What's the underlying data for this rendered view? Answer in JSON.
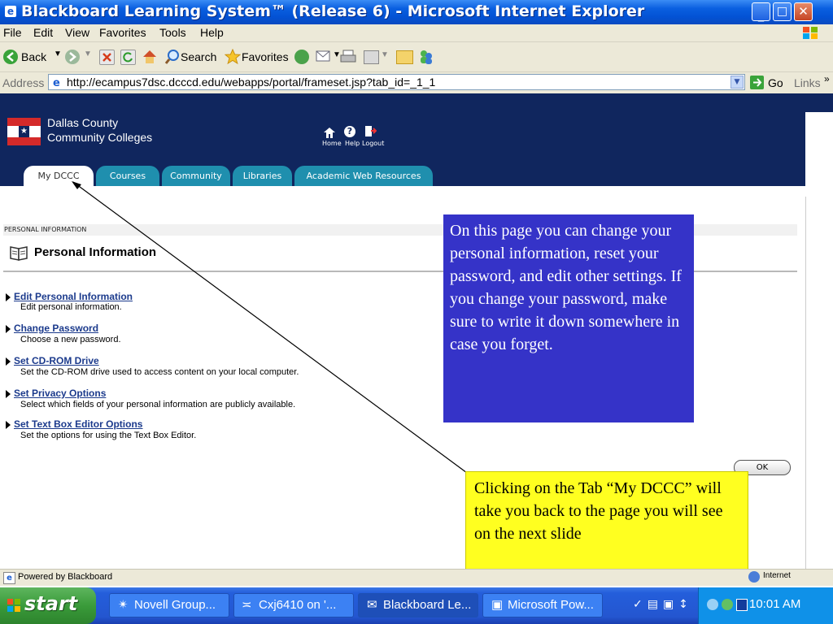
{
  "window": {
    "title": "Blackboard Learning System™ (Release 6) - Microsoft Internet Explorer"
  },
  "menu": [
    "File",
    "Edit",
    "View",
    "Favorites",
    "Tools",
    "Help"
  ],
  "toolbar": {
    "back_label": "Back",
    "search_label": "Search",
    "favorites_label": "Favorites"
  },
  "address": {
    "label": "Address",
    "url": "http://ecampus7dsc.dcccd.edu/webapps/portal/frameset.jsp?tab_id=_1_1",
    "go_label": "Go",
    "links_label": "Links"
  },
  "header": {
    "logo_line1": "Dallas County",
    "logo_line2": "Community Colleges",
    "home_label": "Home",
    "help_label": "Help",
    "logout_label": "Logout"
  },
  "tabs": [
    {
      "label": "My DCCC",
      "active": true
    },
    {
      "label": "Courses",
      "active": false
    },
    {
      "label": "Community",
      "active": false
    },
    {
      "label": "Libraries",
      "active": false
    },
    {
      "label": "Academic Web Resources",
      "active": false
    }
  ],
  "content": {
    "breadcrumb": "PERSONAL INFORMATION",
    "page_title": "Personal Information",
    "items": [
      {
        "title": "Edit Personal Information",
        "desc": "Edit personal information."
      },
      {
        "title": "Change Password",
        "desc": "Choose a new password."
      },
      {
        "title": "Set CD-ROM Drive",
        "desc": "Set the CD-ROM drive used to access content on your local computer."
      },
      {
        "title": "Set Privacy Options",
        "desc": "Select which fields of your personal information are publicly available."
      },
      {
        "title": "Set Text Box Editor Options",
        "desc": "Set the options for using the Text Box Editor."
      }
    ],
    "ok_label": "OK"
  },
  "callouts": {
    "blue": "On this page you can change your personal information, reset your password, and edit other settings. If you change your password, make sure to write it down somewhere in case you forget.",
    "yellow": "Clicking on the Tab “My DCCC” will take you back to the page you will see on the next slide"
  },
  "status": {
    "text": "Powered by Blackboard",
    "zone": "Internet"
  },
  "taskbar": {
    "start_label": "start",
    "tasks": [
      "Novell Group...",
      "Cxj6410 on '...",
      "Blackboard Le...",
      "Microsoft Pow..."
    ],
    "clock": "10:01 AM"
  },
  "colors": {
    "header_navy": "#10265e",
    "tab_teal": "#1f8fae",
    "callout_blue": "#3533c8",
    "callout_yellow": "#ffff20",
    "link_blue": "#1b3a8c"
  }
}
